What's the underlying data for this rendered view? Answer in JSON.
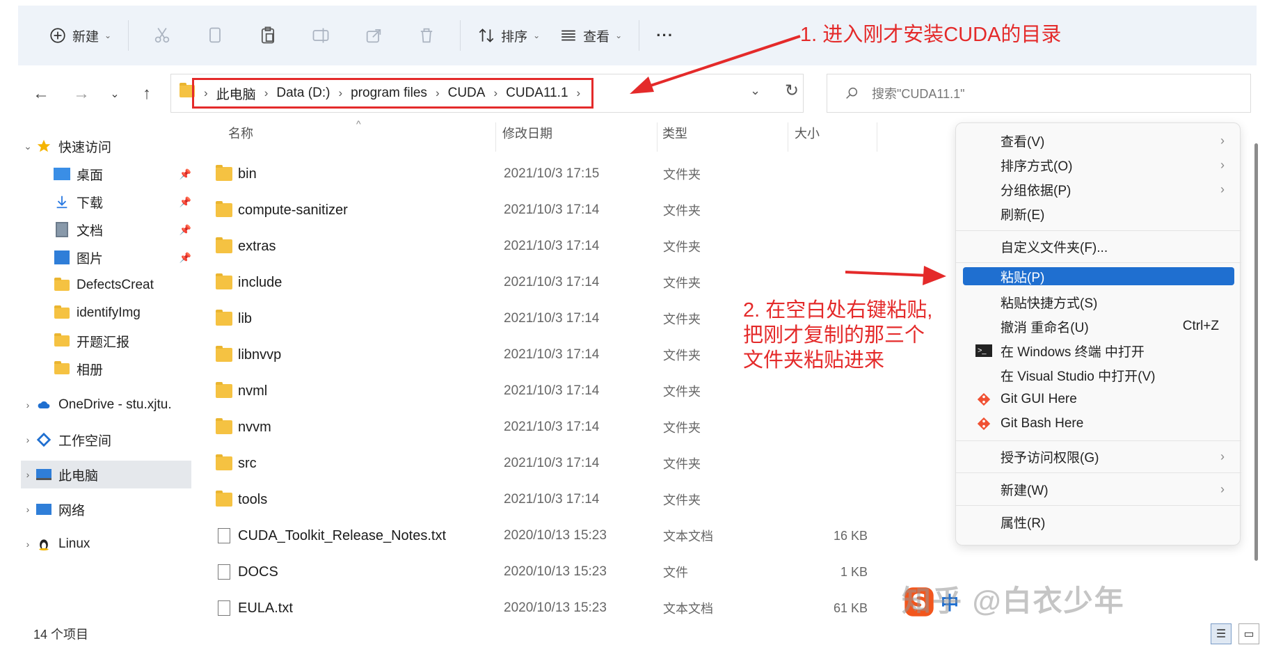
{
  "toolbar": {
    "new_label": "新建",
    "sort_label": "排序",
    "view_label": "查看",
    "more_label": "···"
  },
  "address": {
    "breadcrumbs": [
      "此电脑",
      "Data (D:)",
      "program files",
      "CUDA",
      "CUDA11.1"
    ]
  },
  "search": {
    "placeholder": "搜索\"CUDA11.1\""
  },
  "sidebar": {
    "items": [
      {
        "label": "快速访问",
        "icon": "star-icon"
      },
      {
        "label": "桌面",
        "icon": "desktop-icon"
      },
      {
        "label": "下载",
        "icon": "download-icon"
      },
      {
        "label": "文档",
        "icon": "document-icon"
      },
      {
        "label": "图片",
        "icon": "picture-icon"
      },
      {
        "label": "DefectsCreat",
        "icon": "folder-icon"
      },
      {
        "label": "identifyImg",
        "icon": "folder-icon"
      },
      {
        "label": "开题汇报",
        "icon": "folder-icon"
      },
      {
        "label": "相册",
        "icon": "folder-icon"
      },
      {
        "label": "OneDrive - stu.xjtu.",
        "icon": "cloud-icon"
      },
      {
        "label": "工作空间",
        "icon": "workspace-icon"
      },
      {
        "label": "此电脑",
        "icon": "computer-icon"
      },
      {
        "label": "网络",
        "icon": "network-icon"
      },
      {
        "label": "Linux",
        "icon": "linux-icon"
      }
    ]
  },
  "columns": {
    "name": "名称",
    "modified": "修改日期",
    "type": "类型",
    "size": "大小"
  },
  "files": [
    {
      "name": "bin",
      "modified": "2021/10/3 17:15",
      "type": "文件夹",
      "size": "",
      "kind": "folder"
    },
    {
      "name": "compute-sanitizer",
      "modified": "2021/10/3 17:14",
      "type": "文件夹",
      "size": "",
      "kind": "folder"
    },
    {
      "name": "extras",
      "modified": "2021/10/3 17:14",
      "type": "文件夹",
      "size": "",
      "kind": "folder"
    },
    {
      "name": "include",
      "modified": "2021/10/3 17:14",
      "type": "文件夹",
      "size": "",
      "kind": "folder"
    },
    {
      "name": "lib",
      "modified": "2021/10/3 17:14",
      "type": "文件夹",
      "size": "",
      "kind": "folder"
    },
    {
      "name": "libnvvp",
      "modified": "2021/10/3 17:14",
      "type": "文件夹",
      "size": "",
      "kind": "folder"
    },
    {
      "name": "nvml",
      "modified": "2021/10/3 17:14",
      "type": "文件夹",
      "size": "",
      "kind": "folder"
    },
    {
      "name": "nvvm",
      "modified": "2021/10/3 17:14",
      "type": "文件夹",
      "size": "",
      "kind": "folder"
    },
    {
      "name": "src",
      "modified": "2021/10/3 17:14",
      "type": "文件夹",
      "size": "",
      "kind": "folder"
    },
    {
      "name": "tools",
      "modified": "2021/10/3 17:14",
      "type": "文件夹",
      "size": "",
      "kind": "folder"
    },
    {
      "name": "CUDA_Toolkit_Release_Notes.txt",
      "modified": "2020/10/13 15:23",
      "type": "文本文档",
      "size": "16 KB",
      "kind": "file"
    },
    {
      "name": "DOCS",
      "modified": "2020/10/13 15:23",
      "type": "文件",
      "size": "1 KB",
      "kind": "file"
    },
    {
      "name": "EULA.txt",
      "modified": "2020/10/13 15:23",
      "type": "文本文档",
      "size": "61 KB",
      "kind": "file"
    }
  ],
  "status": {
    "count": "14 个项目"
  },
  "context_menu": {
    "items": [
      {
        "label": "查看(V)",
        "submenu": true
      },
      {
        "label": "排序方式(O)",
        "submenu": true
      },
      {
        "label": "分组依据(P)",
        "submenu": true
      },
      {
        "label": "刷新(E)"
      },
      {
        "label": "自定义文件夹(F)..."
      },
      {
        "label": "粘贴(P)",
        "active": true
      },
      {
        "label": "粘贴快捷方式(S)"
      },
      {
        "label": "撤消 重命名(U)",
        "shortcut": "Ctrl+Z"
      },
      {
        "label": "在 Windows 终端 中打开",
        "icon": "terminal-icon"
      },
      {
        "label": "在 Visual Studio 中打开(V)"
      },
      {
        "label": "Git GUI Here",
        "icon": "git-icon"
      },
      {
        "label": "Git Bash Here",
        "icon": "git-icon"
      },
      {
        "label": "授予访问权限(G)",
        "submenu": true
      },
      {
        "label": "新建(W)",
        "submenu": true
      },
      {
        "label": "属性(R)"
      }
    ]
  },
  "annotations": {
    "step1": "1. 进入刚才安装CUDA的目录",
    "step2_line1": "2. 在空白处右键粘贴,",
    "step2_line2": "把刚才复制的那三个",
    "step2_line3": "文件夹粘贴进来"
  },
  "watermark": {
    "text": "知乎 @白衣少年"
  },
  "ime": {
    "lang": "中"
  },
  "colors": {
    "accent": "#1f6fd0",
    "annotation": "#e42a2a",
    "folder": "#f5c242"
  }
}
